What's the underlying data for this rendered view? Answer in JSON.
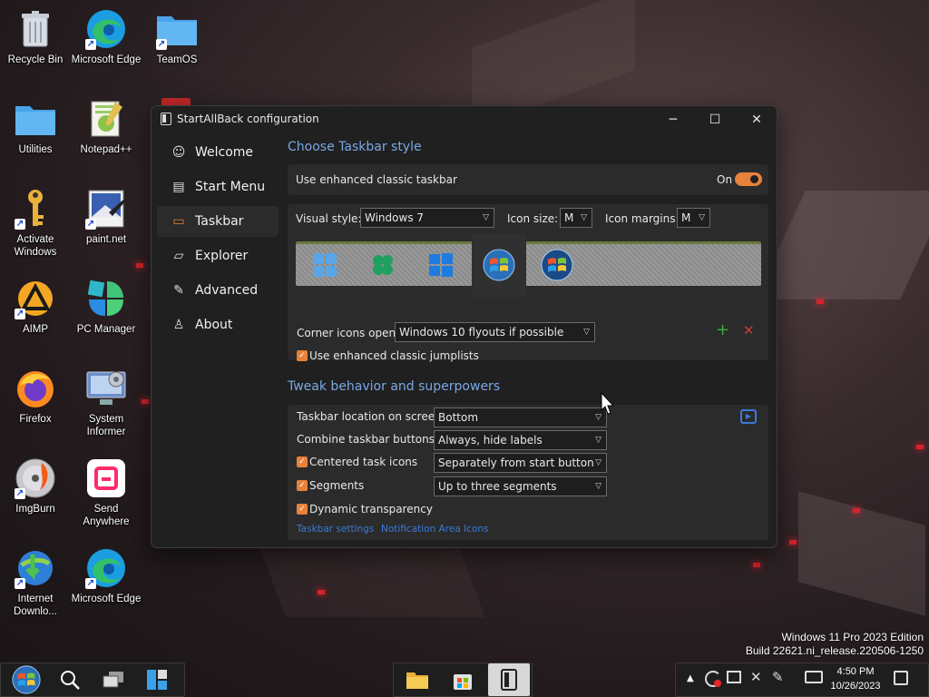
{
  "desktop": {
    "icons": [
      {
        "label": "Recycle Bin"
      },
      {
        "label": "Microsoft Edge"
      },
      {
        "label": "TeamOS"
      },
      {
        "label": "Utilities"
      },
      {
        "label": "Notepad++"
      },
      {
        "label": "Activate Windows"
      },
      {
        "label": "paint.net"
      },
      {
        "label": "AIMP"
      },
      {
        "label": "PC Manager"
      },
      {
        "label": "Firefox"
      },
      {
        "label": "System Informer"
      },
      {
        "label": "ImgBurn"
      },
      {
        "label": "Send Anywhere"
      },
      {
        "label": "Internet Downlo..."
      },
      {
        "label": "Microsoft Edge"
      }
    ]
  },
  "window": {
    "title": "StartAllBack configuration",
    "controls": {
      "minimize": "─",
      "maximize": "☐",
      "close": "✕"
    }
  },
  "sidebar": {
    "items": [
      {
        "label": "Welcome",
        "icon": "☺"
      },
      {
        "label": "Start Menu",
        "icon": "▤"
      },
      {
        "label": "Taskbar",
        "icon": "▭"
      },
      {
        "label": "Explorer",
        "icon": "▱"
      },
      {
        "label": "Advanced",
        "icon": "✎"
      },
      {
        "label": "About",
        "icon": "♙"
      }
    ]
  },
  "taskbar_style": {
    "heading": "Choose Taskbar style",
    "enhanced_label": "Use enhanced classic taskbar",
    "enhanced_state": "On",
    "visual_style_label": "Visual style:",
    "visual_style_value": "Windows 7",
    "icon_size_label": "Icon size:",
    "icon_size_value": "M",
    "icon_margins_label": "Icon margins:",
    "icon_margins_value": "M",
    "corner_icons_label": "Corner icons open:",
    "corner_icons_value": "Windows 10 flyouts if possible",
    "jumplists_label": "Use enhanced classic jumplists",
    "add_symbol": "+",
    "remove_symbol": "✕"
  },
  "tweaks": {
    "heading": "Tweak behavior and superpowers",
    "location_label": "Taskbar location on screen:",
    "location_value": "Bottom",
    "combine_label": "Combine taskbar buttons:",
    "combine_value": "Always, hide labels",
    "centered_label": "Centered task icons",
    "centered_value": "Separately from start button",
    "segments_label": "Segments",
    "segments_value": "Up to three segments",
    "transparency_label": "Dynamic transparency",
    "link_taskbar": "Taskbar settings",
    "link_notification": "Notification Area Icons"
  },
  "system": {
    "edition": "Windows 11 Pro 2023 Edition",
    "build": "Build 22621.ni_release.220506-1250",
    "time": "4:50 PM",
    "date": "10/26/2023"
  },
  "colors": {
    "accent": "#e8823a",
    "heading": "#7aa7e6",
    "link": "#3a7ad8"
  }
}
